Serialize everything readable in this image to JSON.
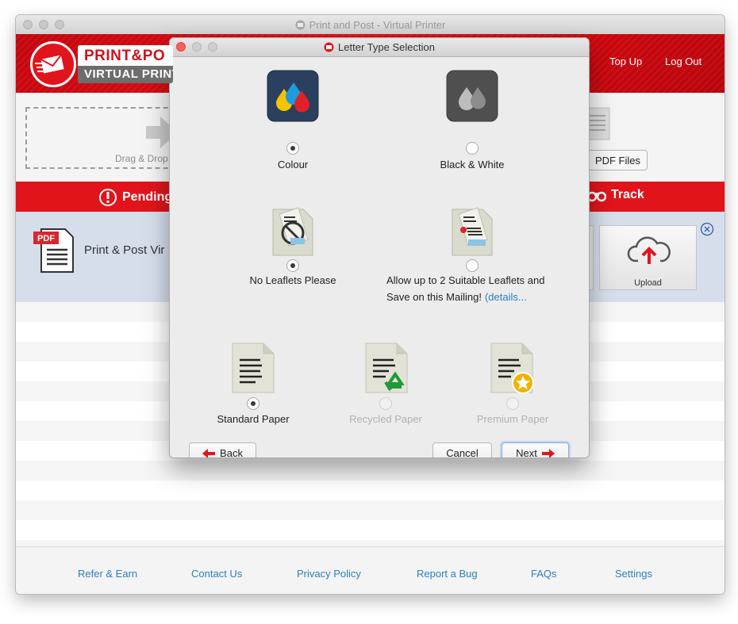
{
  "window": {
    "title": "Print and Post - Virtual Printer"
  },
  "header": {
    "logo_line1": "PRINT&PO",
    "logo_line2": "VIRTUAL PRINT",
    "top_up": "Top Up",
    "log_out": "Log Out",
    "brand_color": "#e2141b"
  },
  "toolbar": {
    "drop_label": "Drag & Drop",
    "pdf_files_label": "PDF Files"
  },
  "tabs": {
    "pending": "Pending",
    "track": "Track"
  },
  "document": {
    "title": "Print & Post Vir",
    "upload_label": "Upload"
  },
  "footer": {
    "links": [
      "Refer & Earn",
      "Contact Us",
      "Privacy Policy",
      "Report a Bug",
      "FAQs",
      "Settings"
    ],
    "link_color": "#2a7fbd"
  },
  "dialog": {
    "title": "Letter Type Selection",
    "colour_label": "Colour",
    "bw_label": "Black & White",
    "no_leaflets_label": "No Leaflets Please",
    "leaflets_label": "Allow up to 2 Suitable Leaflets and Save on this Mailing!",
    "details_link": "(details...",
    "standard_label": "Standard Paper",
    "recycled_label": "Recycled Paper",
    "premium_label": "Premium Paper",
    "back_label": "Back",
    "cancel_label": "Cancel",
    "next_label": "Next",
    "selected_colour": "Colour",
    "selected_leaflets": "No Leaflets Please",
    "selected_paper": "Standard Paper"
  }
}
